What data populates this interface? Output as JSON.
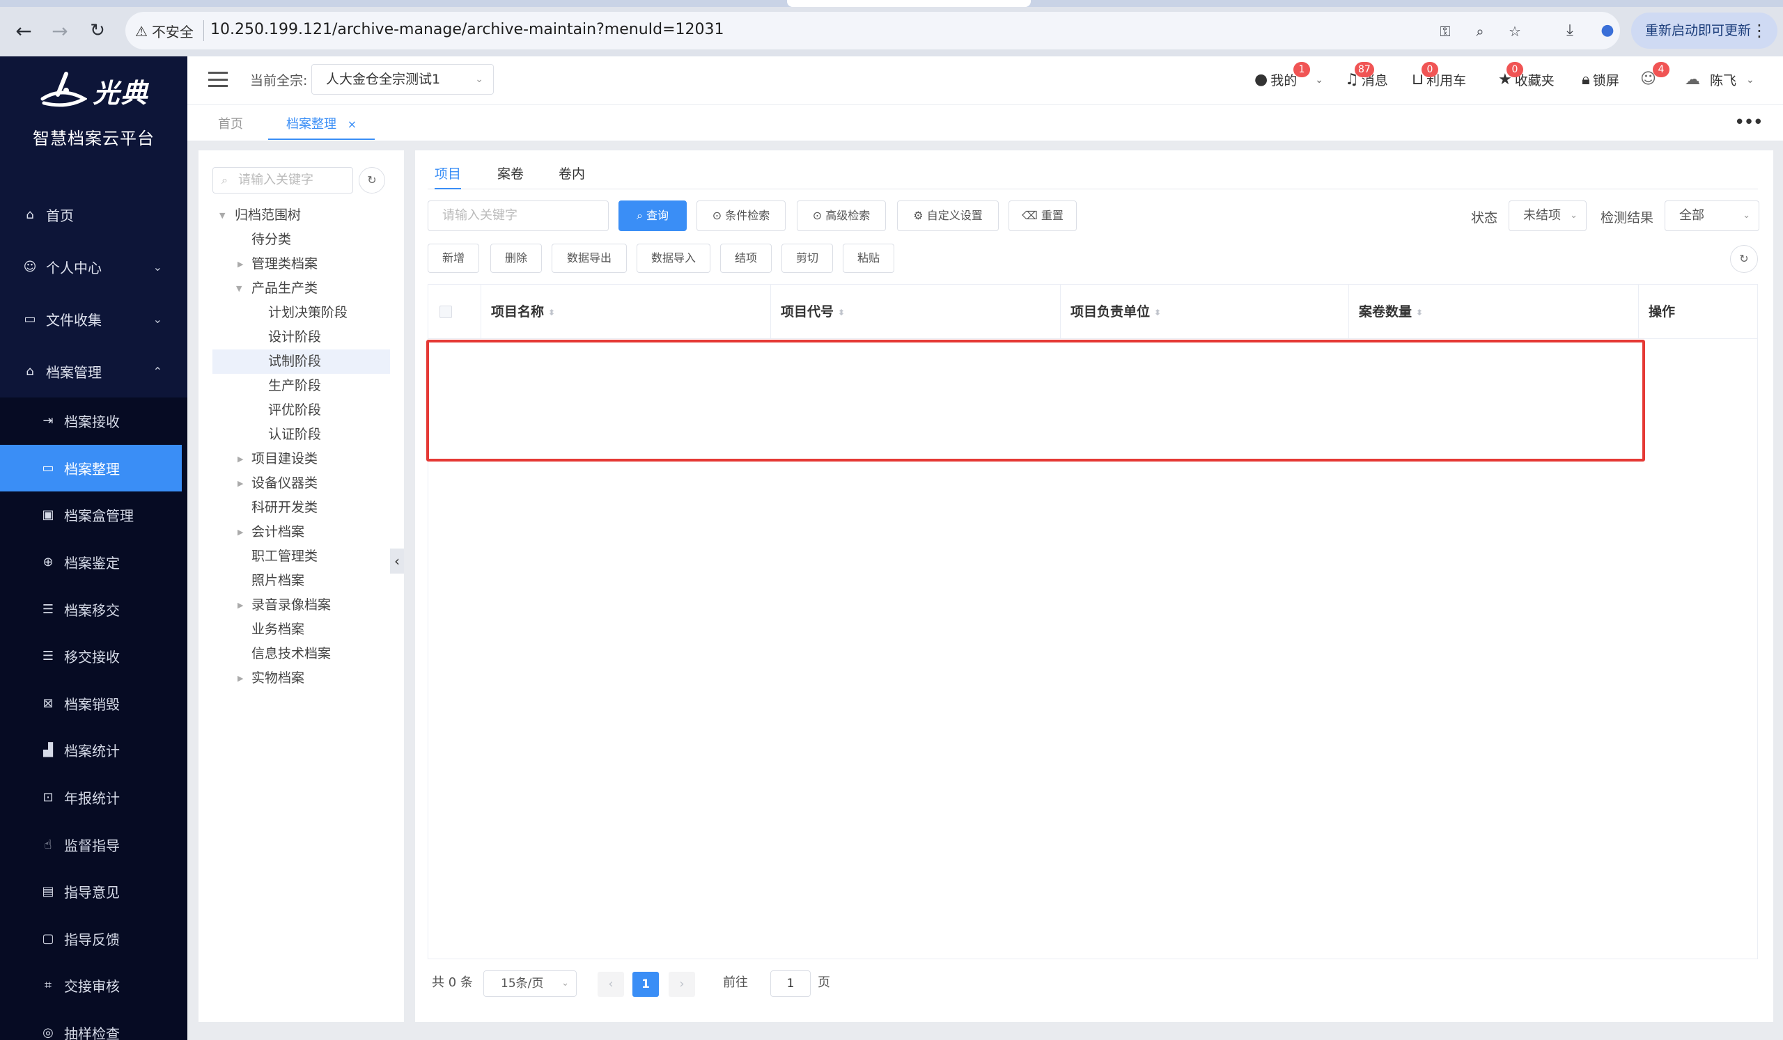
{
  "browser": {
    "security_label": "不安全",
    "url": "10.250.199.121/archive-manage/archive-maintain?menuId=12031",
    "update_button": "重新启动即可更新"
  },
  "brand": {
    "logo_text": "光典",
    "platform_name": "智慧档案云平台"
  },
  "sidebar": {
    "items": [
      {
        "label": "首页",
        "icon": "home-icon"
      },
      {
        "label": "个人中心",
        "icon": "user-icon"
      },
      {
        "label": "文件收集",
        "icon": "folder-icon"
      },
      {
        "label": "档案管理",
        "icon": "bank-icon"
      }
    ],
    "sub_items": [
      {
        "label": "档案接收",
        "icon": "receive-icon"
      },
      {
        "label": "档案整理",
        "icon": "folder-outline-icon"
      },
      {
        "label": "档案盒管理",
        "icon": "box-icon"
      },
      {
        "label": "档案鉴定",
        "icon": "compass-icon"
      },
      {
        "label": "档案移交",
        "icon": "list-icon"
      },
      {
        "label": "移交接收",
        "icon": "list-icon"
      },
      {
        "label": "档案销毁",
        "icon": "delete-box-icon"
      },
      {
        "label": "档案统计",
        "icon": "bar-chart-icon"
      },
      {
        "label": "年报统计",
        "icon": "presentation-icon"
      },
      {
        "label": "监督指导",
        "icon": "hand-icon"
      },
      {
        "label": "指导意见",
        "icon": "message-icon"
      },
      {
        "label": "指导反馈",
        "icon": "chat-icon"
      },
      {
        "label": "交接审核",
        "icon": "crop-icon"
      },
      {
        "label": "抽样检查",
        "icon": "check-icon"
      }
    ]
  },
  "header": {
    "quanzong_label": "当前全宗:",
    "quanzong_value": "人大金仓全宗测试1",
    "my_label": "我的",
    "my_badge": "1",
    "msg_label": "消息",
    "msg_badge": "87",
    "cart_label": "利用车",
    "cart_badge": "0",
    "fav_label": "收藏夹",
    "fav_badge": "0",
    "lock_label": "锁屏",
    "users_badge": "4",
    "user_name": "陈飞"
  },
  "page_tabs": [
    {
      "label": "首页"
    },
    {
      "label": "档案整理"
    }
  ],
  "tree": {
    "search_placeholder": "请输入关键字",
    "nodes": [
      {
        "label": "归档范围树"
      },
      {
        "label": "待分类"
      },
      {
        "label": "管理类档案"
      },
      {
        "label": "产品生产类"
      },
      {
        "label": "计划决策阶段"
      },
      {
        "label": "设计阶段"
      },
      {
        "label": "试制阶段"
      },
      {
        "label": "生产阶段"
      },
      {
        "label": "评优阶段"
      },
      {
        "label": "认证阶段"
      },
      {
        "label": "项目建设类"
      },
      {
        "label": "设备仪器类"
      },
      {
        "label": "科研开发类"
      },
      {
        "label": "会计档案"
      },
      {
        "label": "职工管理类"
      },
      {
        "label": "照片档案"
      },
      {
        "label": "录音录像档案"
      },
      {
        "label": "业务档案"
      },
      {
        "label": "信息技术档案"
      },
      {
        "label": "实物档案"
      }
    ]
  },
  "main": {
    "sub_tabs": [
      "项目",
      "案卷",
      "卷内"
    ],
    "query_placeholder": "请输入关键字",
    "buttons": {
      "query": "查询",
      "condition_search": "条件检索",
      "advanced_search": "高级检索",
      "custom_settings": "自定义设置",
      "reset": "重置"
    },
    "status_label": "状态",
    "status_value": "未结项",
    "result_label": "检测结果",
    "result_value": "全部",
    "actions": [
      "新增",
      "删除",
      "数据导出",
      "数据导入",
      "结项",
      "剪切",
      "粘贴"
    ],
    "columns": [
      "项目名称",
      "项目代号",
      "项目负责单位",
      "案卷数量",
      "操作"
    ]
  },
  "pager": {
    "total": "共 0 条",
    "page_size": "15条/页",
    "current_page": "1",
    "goto_label": "前往",
    "goto_value": "1",
    "page_suffix": "页"
  }
}
